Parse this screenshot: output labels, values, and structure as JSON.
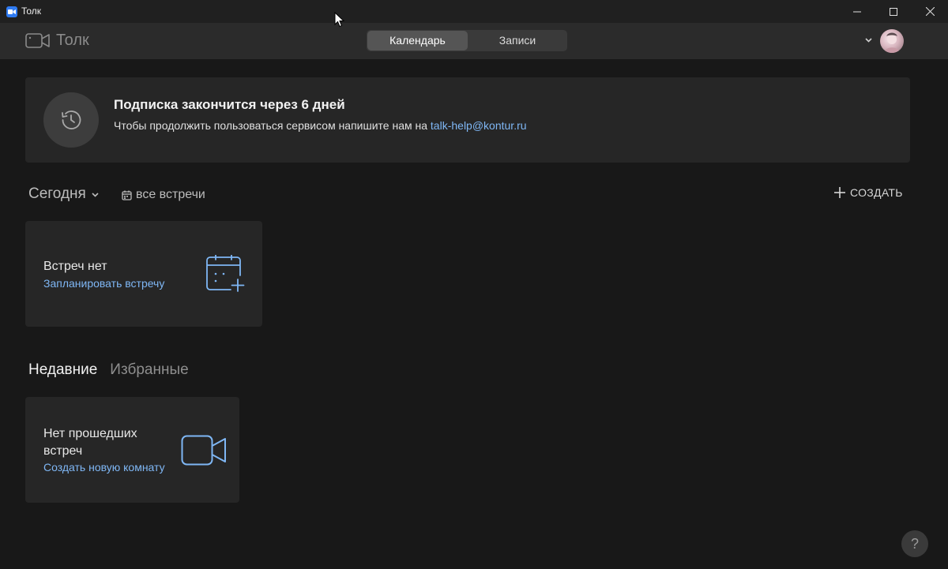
{
  "window": {
    "title": "Толк"
  },
  "header": {
    "logo_text": "Толк",
    "tabs": [
      {
        "label": "Календарь"
      },
      {
        "label": "Записи"
      }
    ]
  },
  "banner": {
    "title": "Подписка закончится через 6 дней",
    "text": "Чтобы продолжить пользоваться сервисом напишите нам на ",
    "email": "talk-help@kontur.ru"
  },
  "today": {
    "label": "Сегодня",
    "all_meetings": "все встречи",
    "create_label": "СОЗДАТЬ"
  },
  "meetings_card": {
    "title": "Встреч нет",
    "link": "Запланировать встречу"
  },
  "sections": {
    "recent": "Недавние",
    "favorites": "Избранные"
  },
  "recent_card": {
    "title_line1": "Нет прошедших",
    "title_line2": "встреч",
    "link": "Создать новую комнату"
  },
  "help": {
    "label": "?"
  },
  "colors": {
    "accent_link": "#7fb7f5",
    "background": "#181818",
    "card": "#262626",
    "header": "#2b2b2b"
  }
}
